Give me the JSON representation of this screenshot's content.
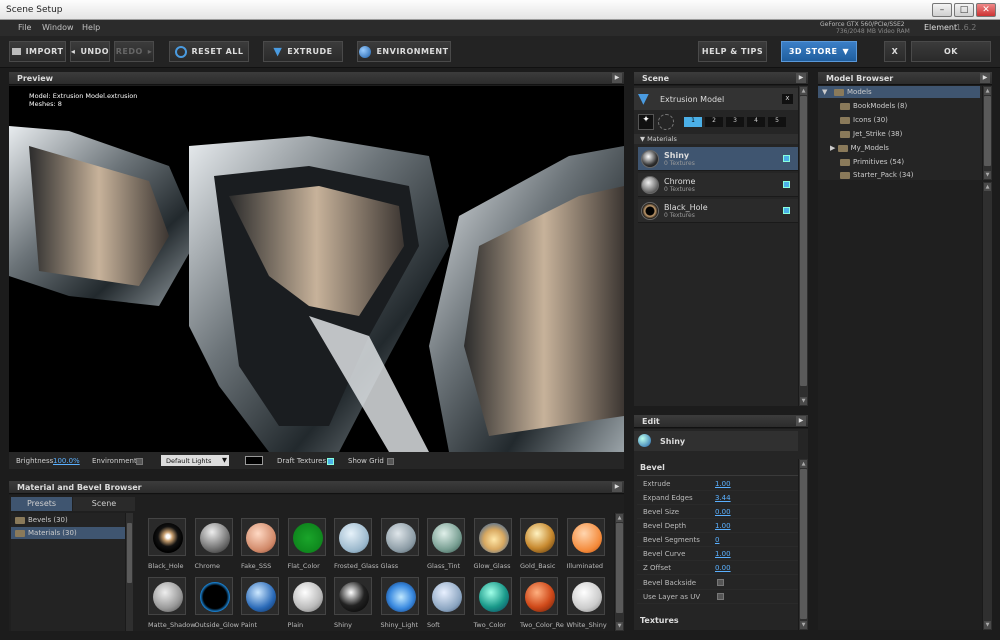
{
  "window": {
    "title": "Scene Setup"
  },
  "menu": [
    "File",
    "Window",
    "Help"
  ],
  "gpu": {
    "line1": "GeForce GTX 560/PCIe/SSE2",
    "line2": "736/2048 MB Video RAM"
  },
  "app": {
    "name": "Element",
    "version": "1.6.2"
  },
  "toolbar": {
    "import": "IMPORT",
    "undo": "UNDO",
    "redo": "REDO",
    "reset": "RESET ALL",
    "extrude": "EXTRUDE",
    "environment": "ENVIRONMENT",
    "help": "HELP & TIPS",
    "store": "3D STORE",
    "close": "X",
    "ok": "OK"
  },
  "preview": {
    "title": "Preview",
    "info": {
      "model": "Model: Extrusion Model.extrusion",
      "meshes": "Meshes: 8"
    },
    "brightness_label": "Brightness",
    "brightness_value": "100.0%",
    "environment_label": "Environment",
    "lights_value": "Default Lights",
    "draft_label": "Draft Textures",
    "grid_label": "Show Grid"
  },
  "scene": {
    "title": "Scene",
    "model_name": "Extrusion Model",
    "close": "x",
    "tabs": [
      "1",
      "2",
      "3",
      "4",
      "5"
    ],
    "materials_label": "Materials",
    "materials": [
      {
        "name": "Shiny",
        "textures": "0 Textures"
      },
      {
        "name": "Chrome",
        "textures": "0 Textures"
      },
      {
        "name": "Black_Hole",
        "textures": "0 Textures"
      }
    ]
  },
  "edit": {
    "title": "Edit",
    "material": "Shiny",
    "bevel_label": "Bevel",
    "props": [
      {
        "name": "Extrude",
        "value": "1.00"
      },
      {
        "name": "Expand Edges",
        "value": "3.44"
      },
      {
        "name": "Bevel Size",
        "value": "0.00"
      },
      {
        "name": "Bevel Depth",
        "value": "1.00"
      },
      {
        "name": "Bevel Segments",
        "value": "0"
      },
      {
        "name": "Bevel Curve",
        "value": "1.00"
      },
      {
        "name": "Z Offset",
        "value": "0.00"
      },
      {
        "name": "Bevel Backside",
        "value": ""
      },
      {
        "name": "Use Layer as UV",
        "value": ""
      }
    ],
    "textures_label": "Textures"
  },
  "model_browser": {
    "title": "Model Browser",
    "root": "Models",
    "items": [
      "BookModels (8)",
      "Icons (30)",
      "Jet_Strike (38)",
      "My_Models",
      "Primitives (54)",
      "Starter_Pack (34)"
    ]
  },
  "mat_browser": {
    "title": "Material and Bevel Browser",
    "tabs": [
      "Presets",
      "Scene"
    ],
    "tree": [
      "Bevels (30)",
      "Materials (30)"
    ],
    "row1": [
      "Black_Hole",
      "Chrome",
      "Fake_SSS",
      "Flat_Color",
      "Frosted_Glass",
      "Glass",
      "Glass_Tint",
      "Glow_Glass",
      "Gold_Basic",
      "Illuminated"
    ],
    "row2": [
      "Matte_Shadow",
      "Outside_Glow",
      "Paint",
      "Plain",
      "Shiny",
      "Shiny_Light",
      "Soft",
      "Two_Color",
      "Two_Color_Re",
      "White_Shiny"
    ]
  },
  "colors": {
    "accent": "#3b7fc7",
    "selection": "#3f5570",
    "link": "#5ab0ff"
  }
}
